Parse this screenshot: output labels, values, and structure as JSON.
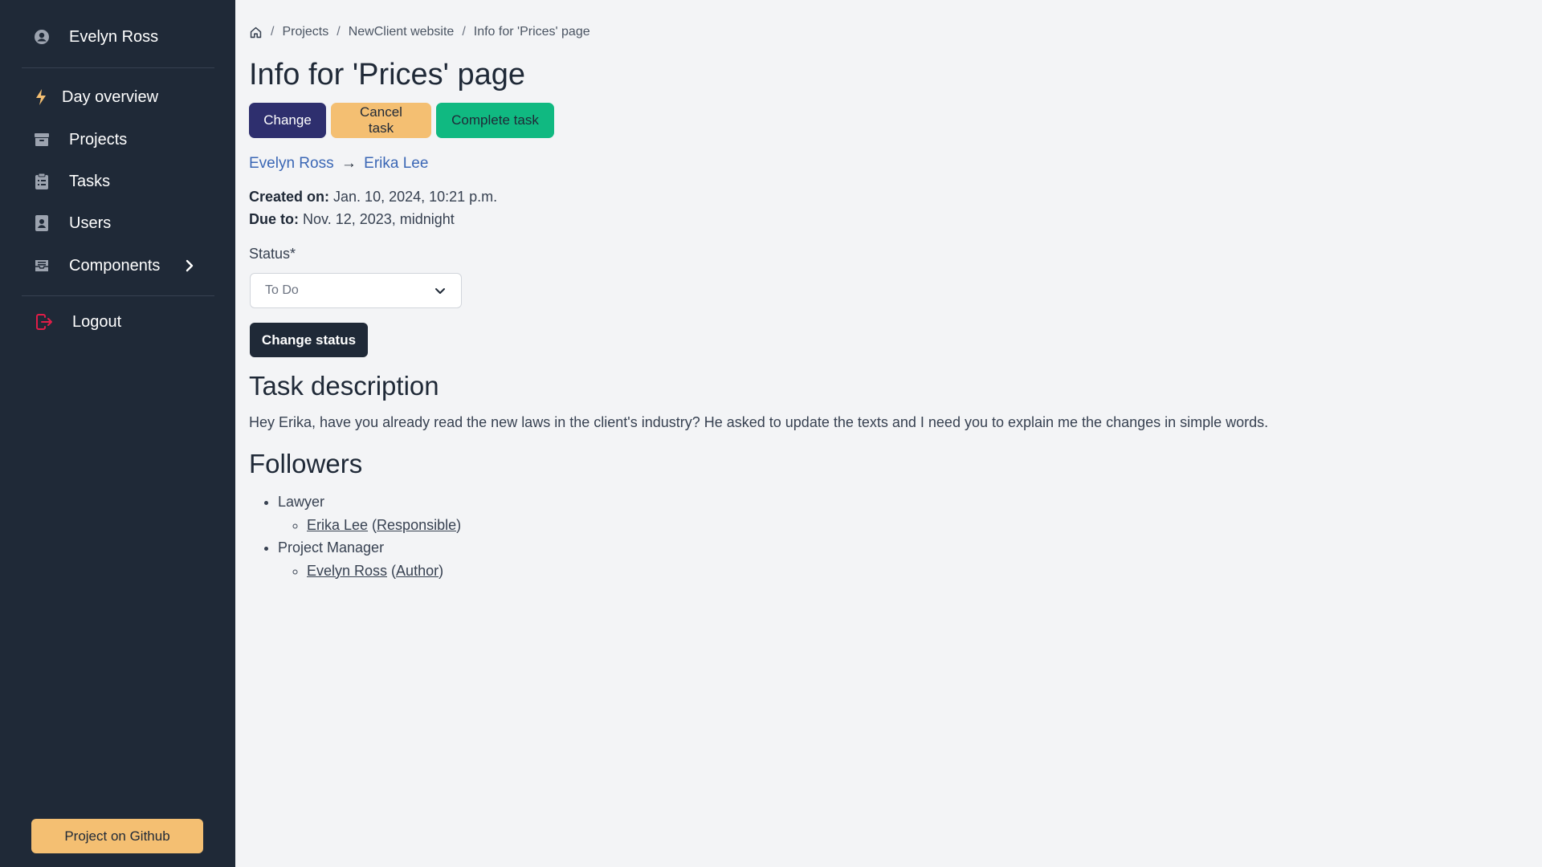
{
  "sidebar": {
    "user_name": "Evelyn Ross",
    "items": [
      {
        "label": "Day overview",
        "icon": "bolt-icon"
      },
      {
        "label": "Projects",
        "icon": "archive-icon"
      },
      {
        "label": "Tasks",
        "icon": "clipboard-icon"
      },
      {
        "label": "Users",
        "icon": "contacts-icon"
      },
      {
        "label": "Components",
        "icon": "inbox-icon"
      }
    ],
    "logout_label": "Logout",
    "github_label": "Project on Github"
  },
  "breadcrumb": {
    "items": [
      "Projects",
      "NewClient website",
      "Info for 'Prices' page"
    ],
    "separator": "/"
  },
  "page": {
    "title": "Info for 'Prices' page",
    "buttons": {
      "change": "Change",
      "cancel": "Cancel task",
      "complete": "Complete task"
    },
    "assign": {
      "from": "Evelyn Ross",
      "arrow": "→",
      "to": "Erika Lee"
    },
    "created_label": "Created on:",
    "created_value": "Jan. 10, 2024, 10:21 p.m.",
    "due_label": "Due to:",
    "due_value": "Nov. 12, 2023, midnight",
    "status_label": "Status*",
    "status_selected": "To Do",
    "change_status_label": "Change status",
    "description_heading": "Task description",
    "description_text": "Hey Erika, have you already read the new laws in the client's industry? He asked to update the texts and I need you to explain me the changes in simple words.",
    "followers_heading": "Followers",
    "followers": [
      {
        "role": "Lawyer",
        "name": "Erika Lee",
        "tag": "Responsible"
      },
      {
        "role": "Project Manager",
        "name": "Evelyn Ross",
        "tag": "Author"
      }
    ]
  },
  "colors": {
    "sidebar_bg": "#1f2937",
    "main_bg": "#f3f4f6",
    "change_btn": "#2e2f6e",
    "cancel_btn": "#f4bf72",
    "complete_btn": "#10b981",
    "link": "#3b67b5",
    "logout_icon": "#e11d48",
    "bolt_icon": "#f4bf72"
  }
}
